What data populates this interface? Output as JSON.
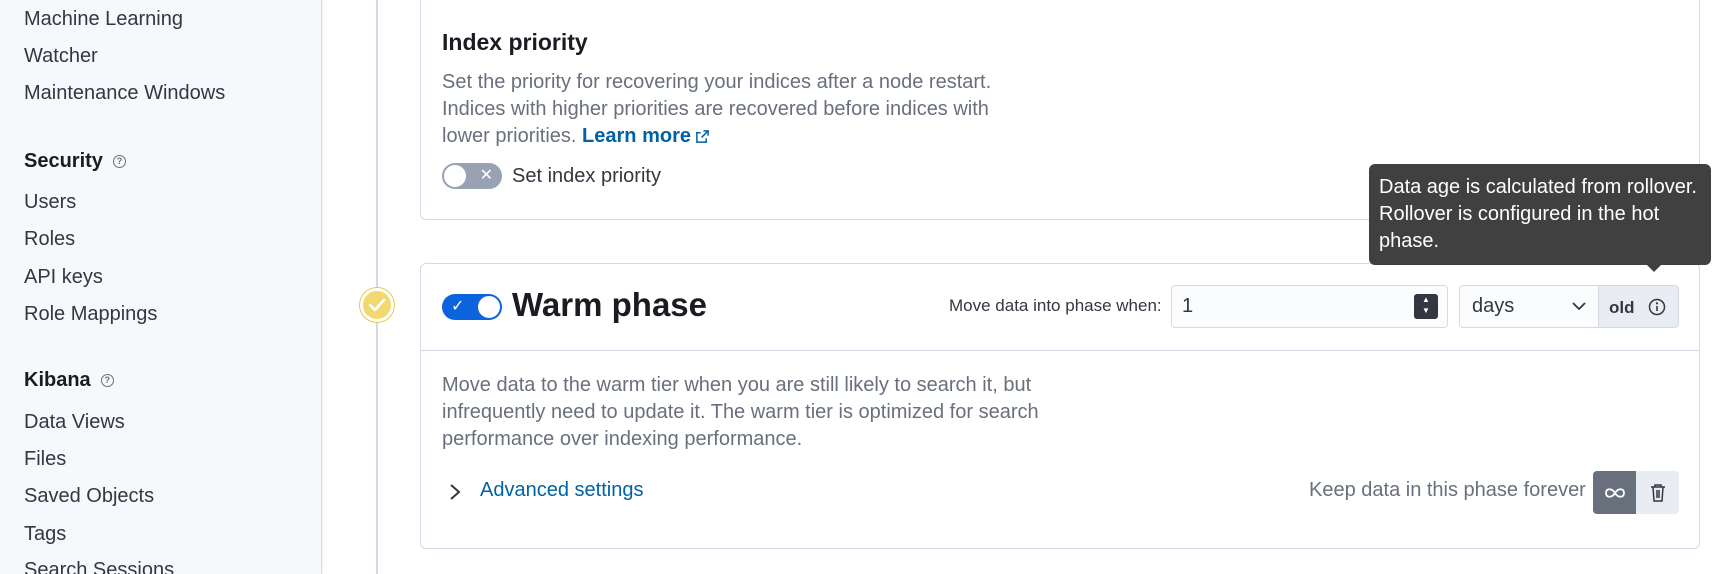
{
  "sidebar": {
    "items_top": [
      "Machine Learning",
      "Watcher",
      "Maintenance Windows"
    ],
    "security": {
      "heading": "Security",
      "items": [
        "Users",
        "Roles",
        "API keys",
        "Role Mappings"
      ]
    },
    "kibana": {
      "heading": "Kibana",
      "items": [
        "Data Views",
        "Files",
        "Saved Objects",
        "Tags",
        "Search Sessions"
      ]
    }
  },
  "index_priority": {
    "title": "Index priority",
    "description": "Set the priority for recovering your indices after a node restart. Indices with higher priorities are recovered before indices with lower priorities.",
    "learn_more": "Learn more",
    "switch_label": "Set index priority",
    "switch_on": false
  },
  "warm_phase": {
    "title": "Warm phase",
    "enabled": true,
    "move_label": "Move data into phase when:",
    "age_value": "1",
    "age_unit": "days",
    "old_label": "old",
    "description": "Move data to the warm tier when you are still likely to search it, but infrequently need to update it. The warm tier is optimized for search performance over indexing performance.",
    "advanced_settings": "Advanced settings",
    "keep_forever_label": "Keep data in this phase forever"
  },
  "tooltip": {
    "text": "Data age is calculated from rollover. Rollover is configured in the hot phase."
  },
  "colors": {
    "accent": "#0061a6",
    "switch_on": "#0b64dd",
    "phase_dot": "#f1d86f",
    "tooltip_bg": "#404040"
  },
  "icons": {
    "help": "question-circle-icon",
    "external": "external-link-icon",
    "check": "check-icon",
    "info": "info-icon",
    "infinity": "infinity-icon",
    "trash": "trash-icon",
    "chevron": "chevron-right-icon"
  }
}
